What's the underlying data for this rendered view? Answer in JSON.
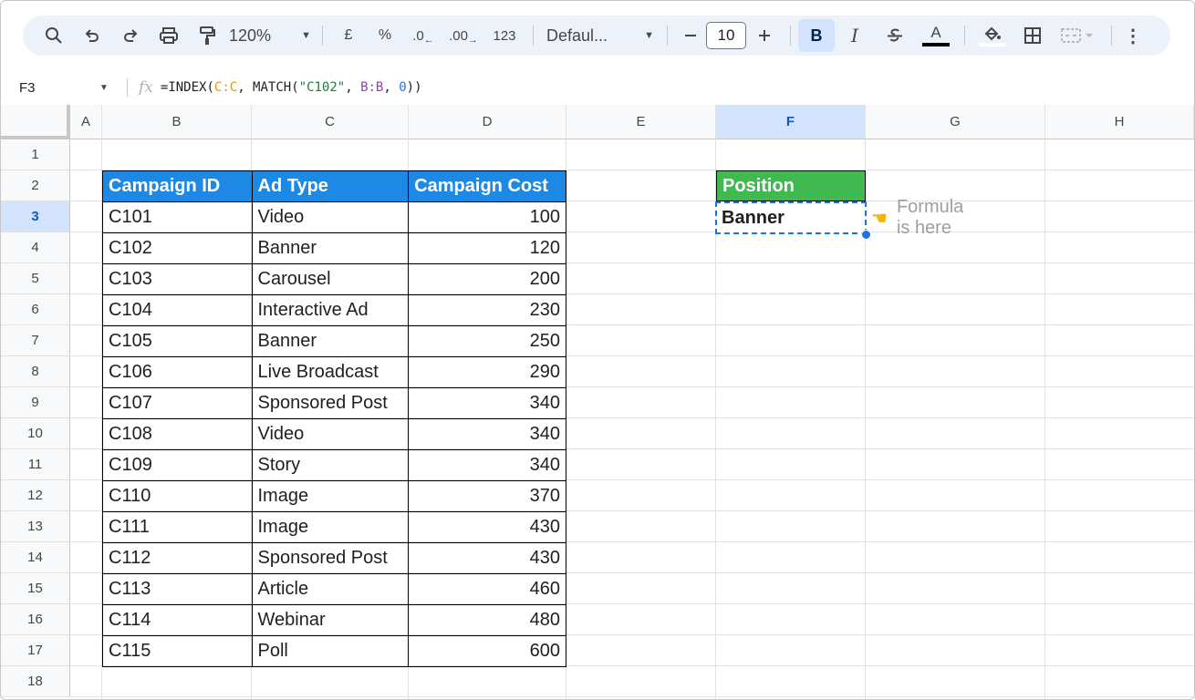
{
  "toolbar": {
    "zoom": "120%",
    "currency_label": "£",
    "percent_label": "%",
    "decrease_decimal_label": ".0",
    "increase_decimal_label": ".00",
    "number_format_label": "123",
    "font": "Defaul...",
    "font_size": "10",
    "bold_label": "B",
    "italic_label": "I",
    "text_color_label": "A",
    "more_label": "⋮"
  },
  "formula_bar": {
    "name_box": "F3",
    "formula_parts": [
      "=INDEX(",
      "C:C",
      ", MATCH(",
      "\"C102\"",
      ", ",
      "B:B",
      ", ",
      "0",
      "))"
    ]
  },
  "columns": [
    "A",
    "B",
    "C",
    "D",
    "E",
    "F",
    "G",
    "H"
  ],
  "rows": [
    "1",
    "2",
    "3",
    "4",
    "5",
    "6",
    "7",
    "8",
    "9",
    "10",
    "11",
    "12",
    "13",
    "14",
    "15",
    "16",
    "17",
    "18"
  ],
  "selected_column": "F",
  "selected_row": "3",
  "table": {
    "headers": [
      "Campaign ID",
      "Ad Type",
      "Campaign Cost"
    ],
    "rows": [
      [
        "C101",
        "Video",
        "100"
      ],
      [
        "C102",
        "Banner",
        "120"
      ],
      [
        "C103",
        "Carousel",
        "200"
      ],
      [
        "C104",
        "Interactive Ad",
        "230"
      ],
      [
        "C105",
        "Banner",
        "250"
      ],
      [
        "C106",
        "Live Broadcast",
        "290"
      ],
      [
        "C107",
        "Sponsored Post",
        "340"
      ],
      [
        "C108",
        "Video",
        "340"
      ],
      [
        "C109",
        "Story",
        "340"
      ],
      [
        "C110",
        "Image",
        "370"
      ],
      [
        "C111",
        "Image",
        "430"
      ],
      [
        "C112",
        "Sponsored Post",
        "430"
      ],
      [
        "C113",
        "Article",
        "460"
      ],
      [
        "C114",
        "Webinar",
        "480"
      ],
      [
        "C115",
        "Poll",
        "600"
      ]
    ]
  },
  "result": {
    "header": "Position",
    "value": "Banner",
    "hint_icon": "pointing-hand-icon",
    "hint": "Formula is here"
  },
  "colors": {
    "table_header": "#1e88e5",
    "position_header": "#3fb950",
    "selection": "#1a73e8",
    "toolbar_bg": "#edf2fa"
  }
}
